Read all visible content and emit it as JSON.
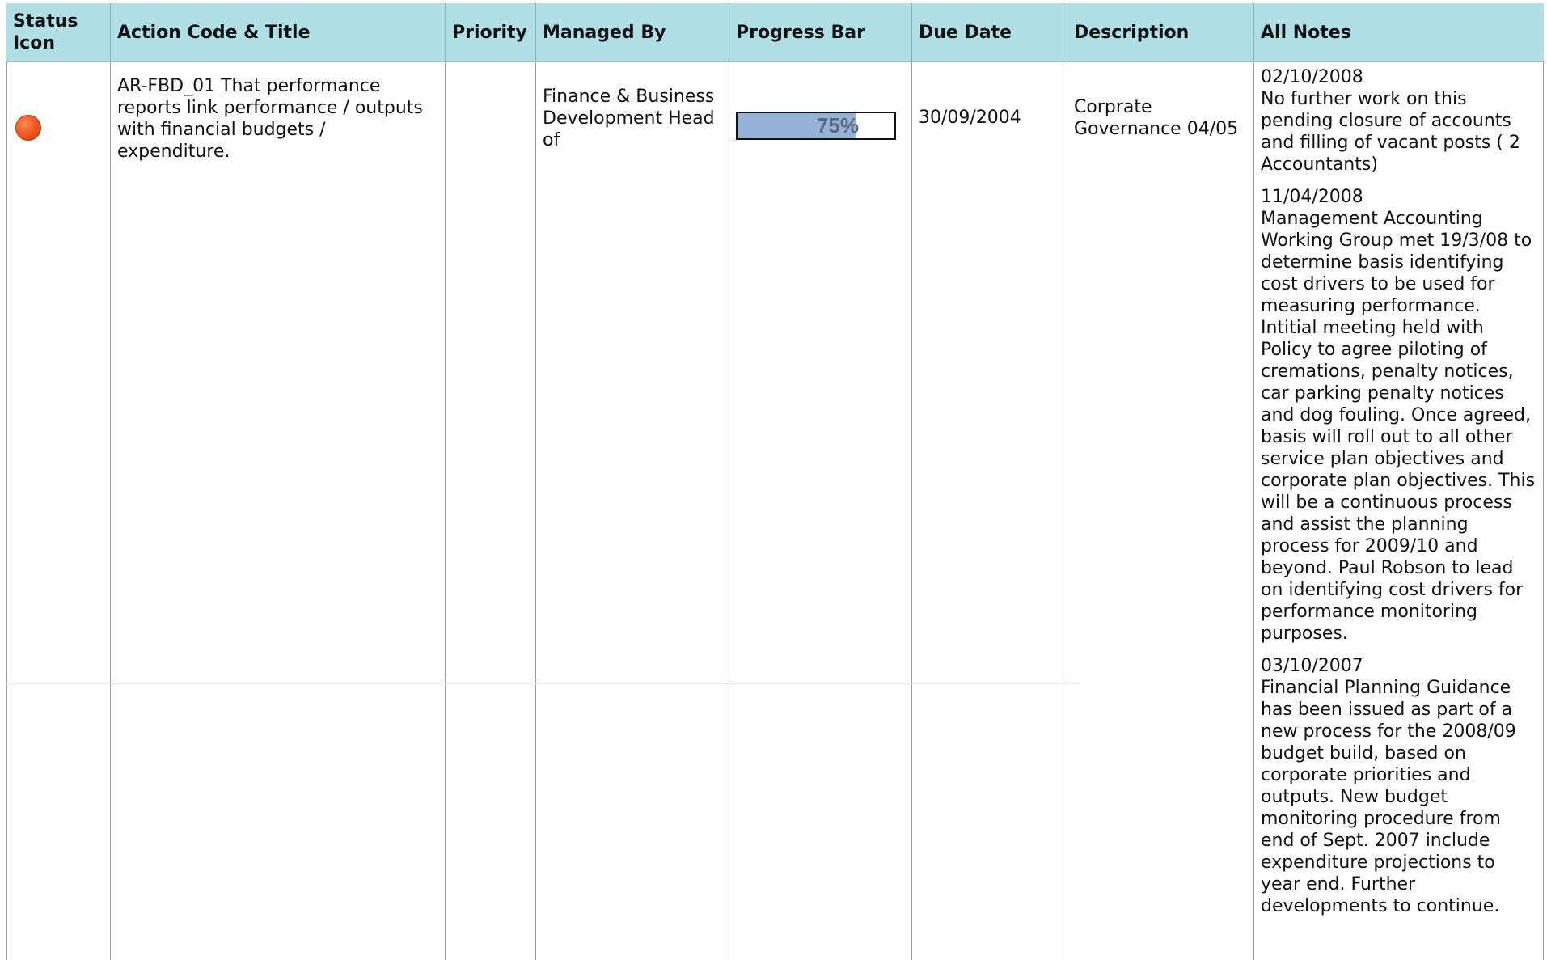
{
  "headers": {
    "status": "Status Icon",
    "action": "Action Code & Title",
    "priority": "Priority",
    "managed_by": "Managed By",
    "progress": "Progress Bar",
    "due_date": "Due Date",
    "description": "Description",
    "notes": "All Notes"
  },
  "colors": {
    "header_bg": "#b0e0e6",
    "status_red": "#f15a22",
    "progress_fill": "#95b3d7"
  },
  "row": {
    "status_icon": "red-circle-icon",
    "action": "AR-FBD_01 That performance reports link performance / outputs with financial budgets / expenditure.",
    "priority": "",
    "managed_by": "Finance & Business Development Head of",
    "progress_value": 0.75,
    "progress_label": "75%",
    "due_date": "30/09/2004",
    "description": "Corprate Governance 04/05",
    "notes": [
      {
        "date": "02/10/2008",
        "text": "No further work on this pending closure of accounts and filling of vacant posts ( 2 Accountants)"
      },
      {
        "date": "11/04/2008",
        "text": "Management Accounting Working Group met 19/3/08 to determine basis identifying cost drivers to be used for measuring performance. Intitial meeting held with Policy to agree piloting of cremations, penalty notices, car parking penalty notices and dog fouling. Once agreed, basis will roll out to all other service plan objectives and corporate plan objectives. This will be a continuous process and assist the planning process for 2009/10 and beyond. Paul Robson to lead on identifying cost drivers for performance monitoring purposes."
      },
      {
        "date": "03/10/2007",
        "text": "Financial Planning Guidance has been issued as part of a new process for the 2008/09 budget build, based on corporate priorities and outputs. New budget monitoring procedure from end of Sept. 2007 include expenditure projections to year end. Further developments to continue."
      }
    ]
  }
}
